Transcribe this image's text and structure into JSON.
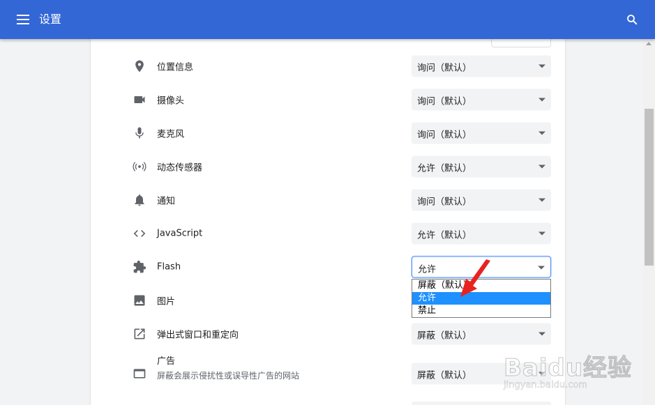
{
  "header": {
    "title": "设置",
    "menu_icon": "menu-icon",
    "search_icon": "search-icon"
  },
  "rows": [
    {
      "icon": "location-icon",
      "label": "位置信息",
      "value": "询问（默认）"
    },
    {
      "icon": "camera-icon",
      "label": "摄像头",
      "value": "询问（默认）"
    },
    {
      "icon": "microphone-icon",
      "label": "麦克风",
      "value": "询问（默认）"
    },
    {
      "icon": "sensors-icon",
      "label": "动态传感器",
      "value": "允许（默认）"
    },
    {
      "icon": "notification-bell-icon",
      "label": "通知",
      "value": "询问（默认）"
    },
    {
      "icon": "code-icon",
      "label": "JavaScript",
      "value": "允许（默认）"
    },
    {
      "icon": "puzzle-icon",
      "label": "Flash",
      "value": "允许"
    },
    {
      "icon": "image-icon",
      "label": "图片",
      "value": ""
    },
    {
      "icon": "open-in-new-icon",
      "label": "弹出式窗口和重定向",
      "value": "屏蔽（默认）"
    },
    {
      "icon": "ads-window-icon",
      "label": "广告",
      "sublabel": "屏蔽会展示侵扰性或误导性广告的网站",
      "value": "屏蔽（默认）"
    }
  ],
  "flash_dropdown": {
    "options": [
      "屏蔽（默认）",
      "允许",
      "禁止"
    ],
    "highlighted": "允许"
  },
  "watermark": {
    "brand": "Baidu经验",
    "url": "jingyan.baidu.com"
  },
  "colors": {
    "header": "#3367d6",
    "highlight": "#1e90ff",
    "arrow": "#e8221f"
  }
}
